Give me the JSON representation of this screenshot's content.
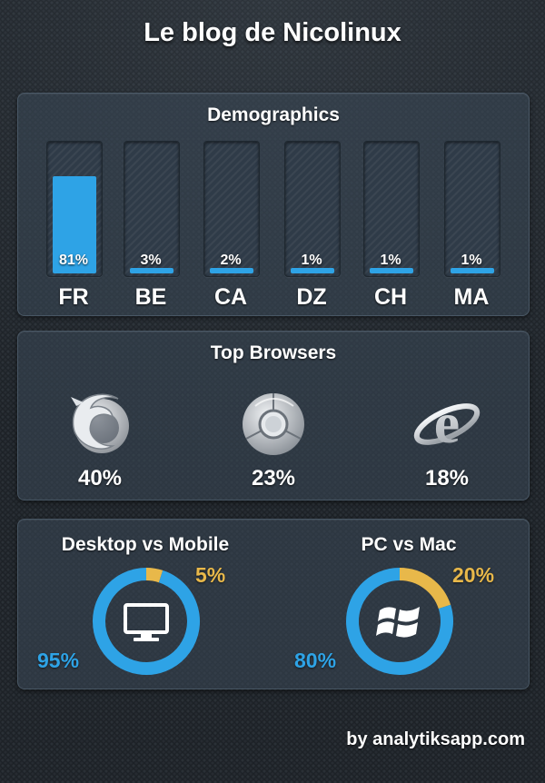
{
  "title": "Le blog de Nicolinux",
  "demographics": {
    "title": "Demographics",
    "colors": {
      "fill": "#2ea3e6"
    }
  },
  "browsers": {
    "title": "Top Browsers",
    "items": [
      {
        "icon": "firefox-icon",
        "pct": "40%"
      },
      {
        "icon": "chrome-icon",
        "pct": "23%"
      },
      {
        "icon": "internet-explorer-icon",
        "pct": "18%"
      }
    ]
  },
  "devices": {
    "desktop_mobile": {
      "title": "Desktop vs Mobile",
      "blue_label": "95%",
      "yellow_label": "5%",
      "icon": "monitor-icon"
    },
    "pc_mac": {
      "title": "PC vs Mac",
      "blue_label": "80%",
      "yellow_label": "20%",
      "icon": "windows-icon"
    },
    "colors": {
      "blue": "#2ea3e6",
      "yellow": "#e8b84a"
    }
  },
  "footer": "by analytiksapp.com",
  "chart_data": [
    {
      "type": "bar",
      "title": "Demographics",
      "categories": [
        "FR",
        "BE",
        "CA",
        "DZ",
        "CH",
        "MA"
      ],
      "values": [
        81,
        3,
        2,
        1,
        1,
        1
      ],
      "labels": [
        "81%",
        "3%",
        "2%",
        "1%",
        "1%",
        "1%"
      ],
      "ylim": [
        0,
        100
      ]
    },
    {
      "type": "pie",
      "title": "Desktop vs Mobile",
      "values": [
        95,
        5
      ],
      "colors": [
        "#2ea3e6",
        "#e8b84a"
      ]
    },
    {
      "type": "pie",
      "title": "PC vs Mac",
      "values": [
        80,
        20
      ],
      "colors": [
        "#2ea3e6",
        "#e8b84a"
      ]
    }
  ]
}
